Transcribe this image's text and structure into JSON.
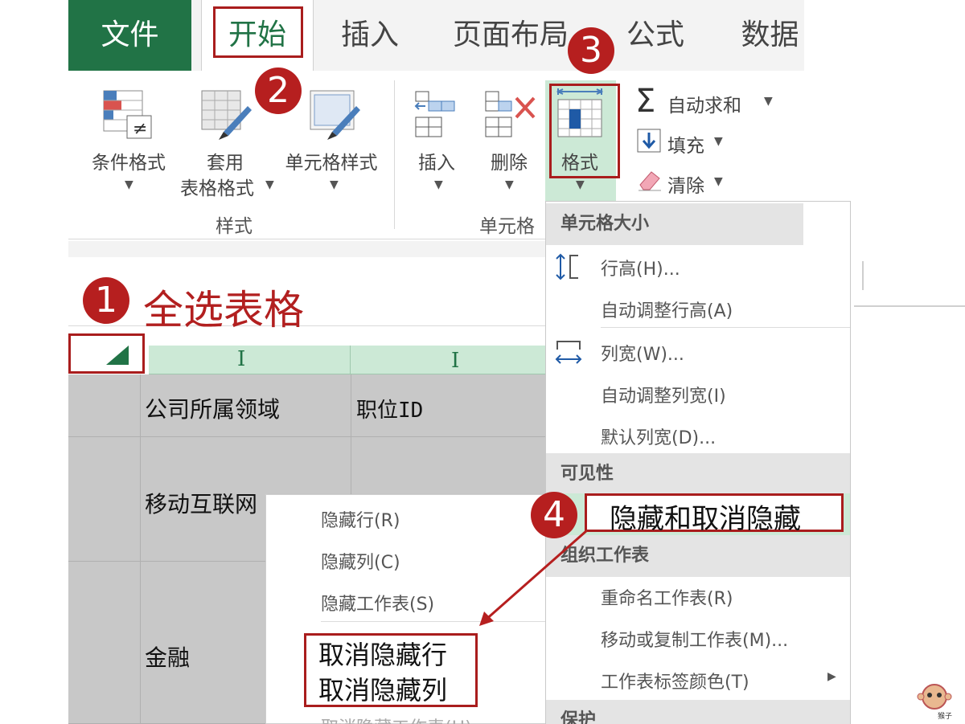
{
  "tabs": [
    "文件",
    "开始",
    "插入",
    "页面布局",
    "公式",
    "数据"
  ],
  "ribbon": {
    "styles": {
      "conditional_format": "条件格式",
      "table_format_line1": "套用",
      "table_format_line2": "表格格式",
      "cell_styles": "单元格样式",
      "group_label": "样式"
    },
    "cells": {
      "insert": "插入",
      "delete": "删除",
      "format": "格式",
      "group_label": "单元格"
    },
    "editing": {
      "autosum": "自动求和",
      "fill": "填充",
      "clear": "清除"
    }
  },
  "annotation": {
    "select_all": "全选表格",
    "hide_unhide": "隐藏和取消隐藏",
    "unhide_rows": "取消隐藏行",
    "unhide_cols": "取消隐藏列"
  },
  "badges": [
    "1",
    "2",
    "3",
    "4"
  ],
  "sheet": {
    "header_cells": [
      "公司所属领域",
      "职位ID"
    ],
    "rows": [
      "移动互联网",
      "金融"
    ],
    "column_marker": "I"
  },
  "format_menu": {
    "cell_size_header": "单元格大小",
    "row_height": "行高(H)...",
    "autofit_row": "自动调整行高(A)",
    "col_width": "列宽(W)...",
    "autofit_col": "自动调整列宽(I)",
    "default_width": "默认列宽(D)...",
    "visibility_header": "可见性",
    "hide_unhide": "隐藏和取消隐藏",
    "organize_header": "组织工作表",
    "rename": "重命名工作表(R)",
    "move_copy": "移动或复制工作表(M)...",
    "tab_color": "工作表标签颜色(T)",
    "protect_header": "保护"
  },
  "hide_submenu": {
    "hide_rows": "隐藏行(R)",
    "hide_cols": "隐藏列(C)",
    "hide_sheet": "隐藏工作表(S)",
    "unhide_sheet": "取消隐藏工作表(H)"
  },
  "watermark": "猴子",
  "colors": {
    "excel_green": "#217346",
    "annotation_red": "#b61f1f",
    "highlight_green": "#cce9d6"
  }
}
